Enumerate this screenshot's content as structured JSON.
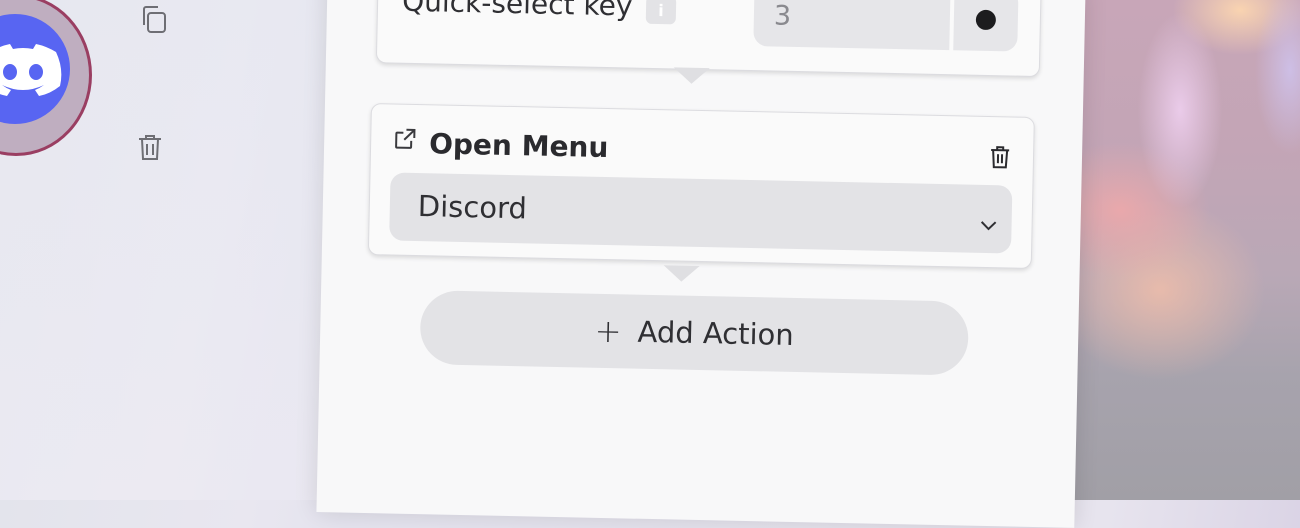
{
  "left_toolbar": {
    "avatar_app": "Discord",
    "icons": [
      "copy-icon",
      "trash-icon"
    ]
  },
  "quick_select": {
    "label": "Quick-select key",
    "info_glyph": "i",
    "value": "3"
  },
  "action_card": {
    "icon": "external-link-icon",
    "title": "Open Menu",
    "selected": "Discord"
  },
  "add_action": {
    "label": "Add Action",
    "plus": "+"
  },
  "colors": {
    "accent_discord": "#5865f2",
    "avatar_border": "#9a3e62"
  }
}
